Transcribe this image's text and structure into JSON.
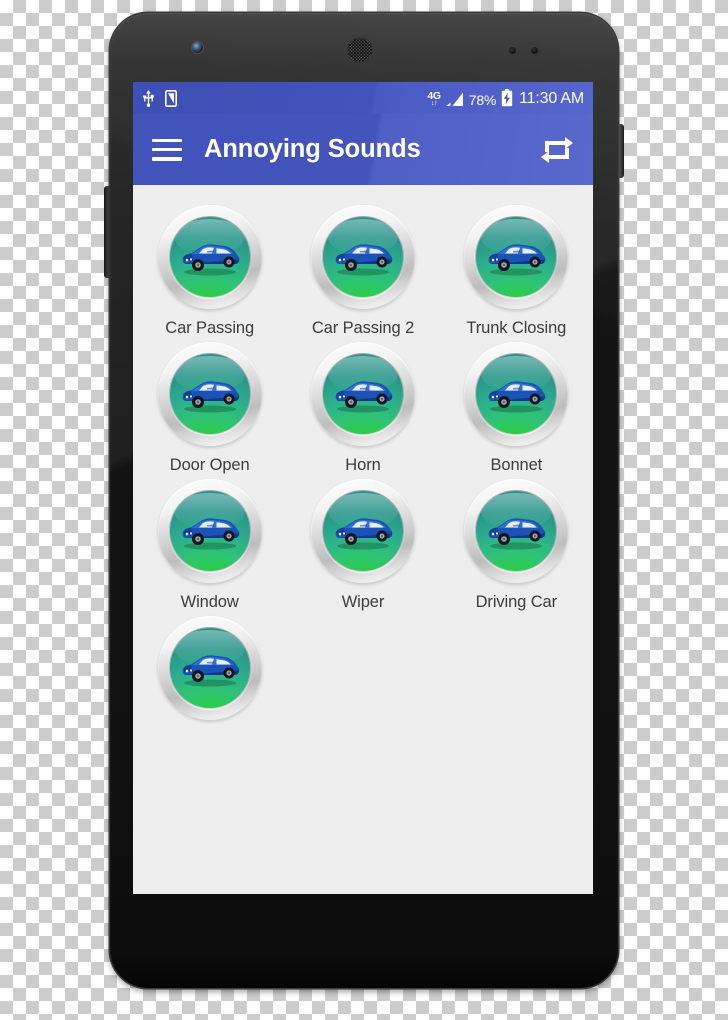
{
  "status_bar": {
    "usb_icon": "usb-icon",
    "sd_card_icon": "sd-card-icon",
    "network_type": "4G",
    "network_arrows": "↓↑",
    "signal_icon": "signal-bars-icon",
    "battery_percent": "78%",
    "battery_icon": "battery-charging-icon",
    "time": "11:30 AM"
  },
  "app_bar": {
    "menu_icon": "hamburger-menu-icon",
    "title": "Annoying Sounds",
    "repeat_icon": "repeat-icon"
  },
  "colors": {
    "status_bar": "#4253bc",
    "app_bar": "#4a5ac4",
    "screen_background": "#eeeeee",
    "label_text": "#3c3c3c",
    "button_ring": "#d2d2d2",
    "button_face_green": "#1fd61b",
    "button_face_teal": "#27938a",
    "car_body": "#1b52b5",
    "phone_body": "#151515"
  },
  "sounds": [
    {
      "label": "Car Passing",
      "icon": "car-icon"
    },
    {
      "label": "Car Passing 2",
      "icon": "car-icon"
    },
    {
      "label": "Trunk Closing",
      "icon": "car-icon"
    },
    {
      "label": "Door Open",
      "icon": "car-icon"
    },
    {
      "label": "Horn",
      "icon": "car-icon"
    },
    {
      "label": "Bonnet",
      "icon": "car-icon"
    },
    {
      "label": "Window",
      "icon": "car-icon"
    },
    {
      "label": "Wiper",
      "icon": "car-icon"
    },
    {
      "label": "Driving Car",
      "icon": "car-icon"
    },
    {
      "label": "",
      "icon": "car-icon"
    }
  ]
}
